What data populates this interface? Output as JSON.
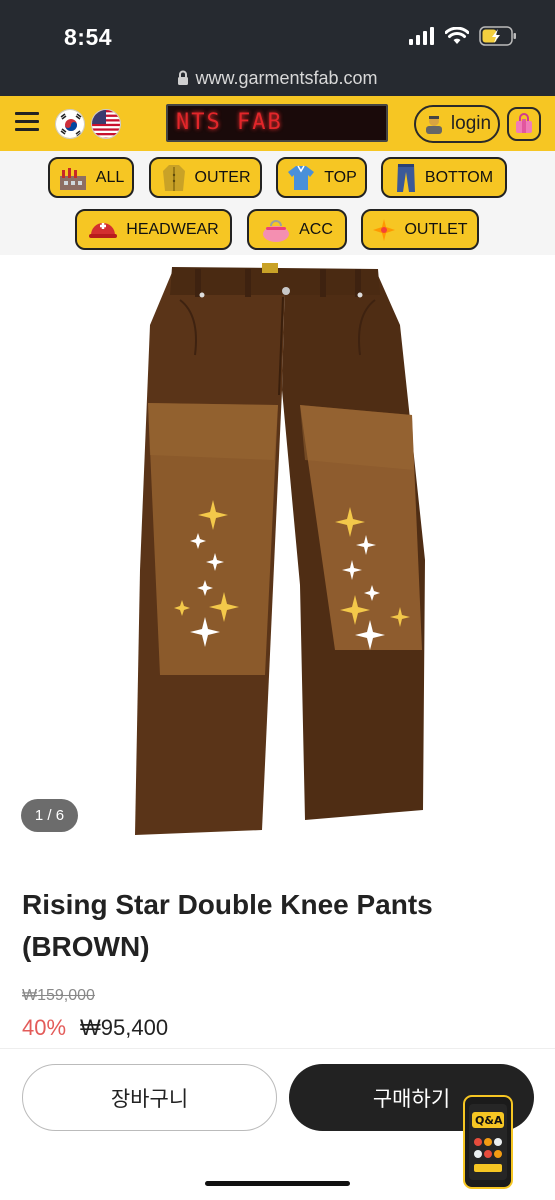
{
  "status": {
    "time": "8:54"
  },
  "browser": {
    "url": "www.garmentsfab.com"
  },
  "header": {
    "ticker": "NTS FAB",
    "login_label": "login"
  },
  "categories": [
    {
      "label": "ALL",
      "icon": "factory-icon"
    },
    {
      "label": "OUTER",
      "icon": "coat-icon"
    },
    {
      "label": "TOP",
      "icon": "shirt-icon"
    },
    {
      "label": "BOTTOM",
      "icon": "jeans-icon"
    },
    {
      "label": "HEADWEAR",
      "icon": "helmet-icon"
    },
    {
      "label": "ACC",
      "icon": "purse-icon"
    },
    {
      "label": "OUTLET",
      "icon": "sparkle-icon"
    }
  ],
  "product": {
    "image_counter": "1 / 6",
    "title": "Rising Star Double Knee Pants (BROWN)",
    "original_price": "₩159,000",
    "discount": "40%",
    "price": "₩95,400"
  },
  "actions": {
    "cart_label": "장바구니",
    "buy_label": "구매하기"
  },
  "qa_badge": {
    "label": "Q&A"
  },
  "colors": {
    "header_yellow": "#f6c623",
    "status_dark": "#262a30",
    "discount_red": "#e35b59",
    "pants_brown": "#5a3418",
    "knee_patch": "#8b5a2b"
  }
}
